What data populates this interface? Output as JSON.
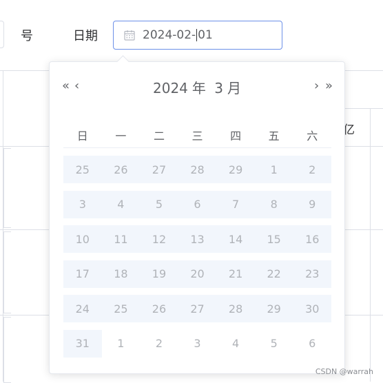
{
  "form": {
    "label_hao": "号",
    "label_date": "日期",
    "date_value_before_caret": "2024-02-",
    "date_value_after_caret": "01"
  },
  "table": {
    "partial_header": "亿"
  },
  "picker": {
    "year": "2024",
    "year_suffix": "年",
    "month": "3",
    "month_suffix": "月",
    "nav": {
      "prev_year": "«",
      "prev_month": "‹",
      "next_month": "›",
      "next_year": "»"
    },
    "weekdays": [
      "日",
      "一",
      "二",
      "三",
      "四",
      "五",
      "六"
    ],
    "weeks": [
      [
        "25",
        "26",
        "27",
        "28",
        "29",
        "1",
        "2"
      ],
      [
        "3",
        "4",
        "5",
        "6",
        "7",
        "8",
        "9"
      ],
      [
        "10",
        "11",
        "12",
        "13",
        "14",
        "15",
        "16"
      ],
      [
        "17",
        "18",
        "19",
        "20",
        "21",
        "22",
        "23"
      ],
      [
        "24",
        "25",
        "26",
        "27",
        "28",
        "29",
        "30"
      ],
      [
        "31",
        "1",
        "2",
        "3",
        "4",
        "5",
        "6"
      ]
    ],
    "range_highlight_color": "#f2f6fc",
    "disabled_text_color": "#b0b3b8"
  },
  "watermark": "CSDN @warrah",
  "icons": {
    "date_input_icon": "calendar-icon"
  },
  "colors": {
    "input_focus_border": "#6b8fe8"
  }
}
